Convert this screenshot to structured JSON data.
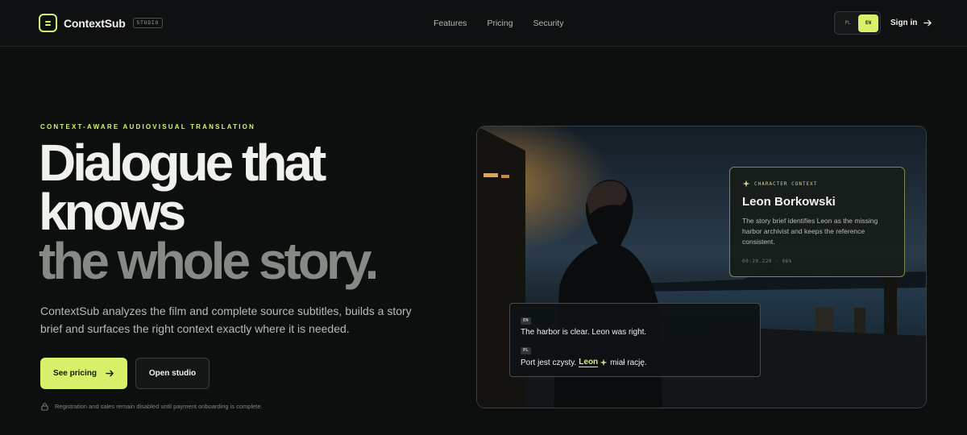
{
  "brand": {
    "name": "ContextSub",
    "badge": "STUDIO"
  },
  "nav": {
    "items": [
      "Features",
      "Pricing",
      "Security"
    ]
  },
  "lang": {
    "pl": "PL",
    "en": "EN",
    "active": "EN"
  },
  "signin": {
    "label": "Sign in"
  },
  "hero": {
    "eyebrow": "CONTEXT-AWARE AUDIOVISUAL TRANSLATION",
    "headline_line1": "Dialogue that",
    "headline_line2": "knows",
    "headline_line3": "the whole story.",
    "subtitle": "ContextSub analyzes the film and complete source subtitles, builds a story brief and surfaces the right context exactly where it is needed.",
    "primary_button": "See pricing",
    "secondary_button": "Open studio",
    "notice": "Registration and sales remain disabled until payment onboarding is complete."
  },
  "context_card": {
    "label": "CHARACTER CONTEXT",
    "name": "Leon Borkowski",
    "description": "The story brief identifies Leon as the missing harbor archivist and keeps the reference consistent.",
    "meta": "00:20.220 · 96%"
  },
  "subtitle_card": {
    "en_tag": "EN",
    "en_text": "The harbor is clear. Leon was right.",
    "pl_tag": "PL",
    "pl_before": "Port jest czysty.",
    "pl_highlight": "Leon",
    "pl_after": "miał rację."
  },
  "colors": {
    "accent": "#d7f26a",
    "background": "#0d0f0e"
  },
  "icons": [
    "logo-icon",
    "arrow-right-icon",
    "lock-icon",
    "sparkle-icon"
  ]
}
